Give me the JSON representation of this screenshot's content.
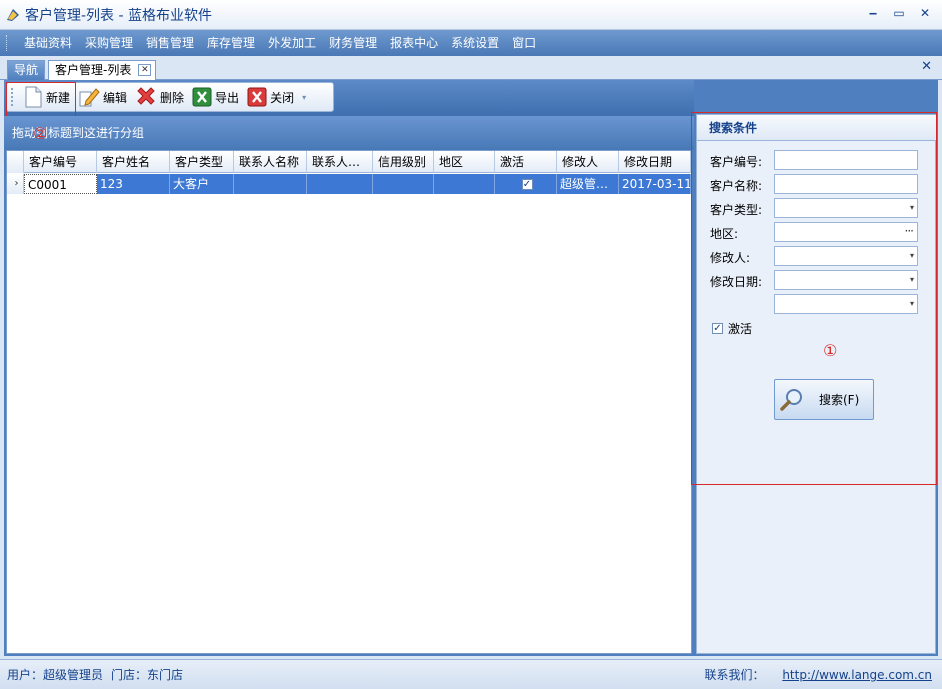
{
  "window": {
    "title": "客户管理-列表 - 蓝格布业软件",
    "minimize": "‒",
    "restore": "▭",
    "close": "✕"
  },
  "menu": [
    "基础资料",
    "采购管理",
    "销售管理",
    "库存管理",
    "外发加工",
    "财务管理",
    "报表中心",
    "系统设置",
    "窗口"
  ],
  "tabs": {
    "nav": "导航",
    "active": "客户管理-列表",
    "tab_close": "✕",
    "strip_close": "✕"
  },
  "toolbar": {
    "new": "新建",
    "edit": "编辑",
    "delete": "删除",
    "export": "导出",
    "close": "关闭",
    "more": "▾"
  },
  "annotations": {
    "mark_1": "①",
    "mark_2": "②"
  },
  "group_hint": "拖动列标题到这进行分组",
  "grid": {
    "columns": [
      "客户编号",
      "客户姓名",
      "客户类型",
      "联系人名称",
      "联系人…",
      "信用级别",
      "地区",
      "激活",
      "修改人",
      "修改日期"
    ],
    "rows": [
      {
        "indicator": "›",
        "code": "C0001",
        "name": "123",
        "type": "大客户",
        "contact": "",
        "contact2": "",
        "credit": "",
        "region": "",
        "active_mark": "✓",
        "modifier": "超级管…",
        "date": "2017-03-11"
      }
    ]
  },
  "search": {
    "title": "搜索条件",
    "labels": {
      "code": "客户编号:",
      "name": "客户名称:",
      "type": "客户类型:",
      "region": "地区:",
      "modifier": "修改人:",
      "date": "修改日期:"
    },
    "drop_arrow": "▾",
    "ellipsis": "···",
    "active_label": "激活",
    "active_mark": "✓",
    "button": "搜索(F)"
  },
  "status": {
    "user_label": "用户：",
    "user": "超级管理员",
    "store_label": "门店：",
    "store": "东门店",
    "contact_label": "联系我们：",
    "url": "http://www.lange.com.cn"
  }
}
